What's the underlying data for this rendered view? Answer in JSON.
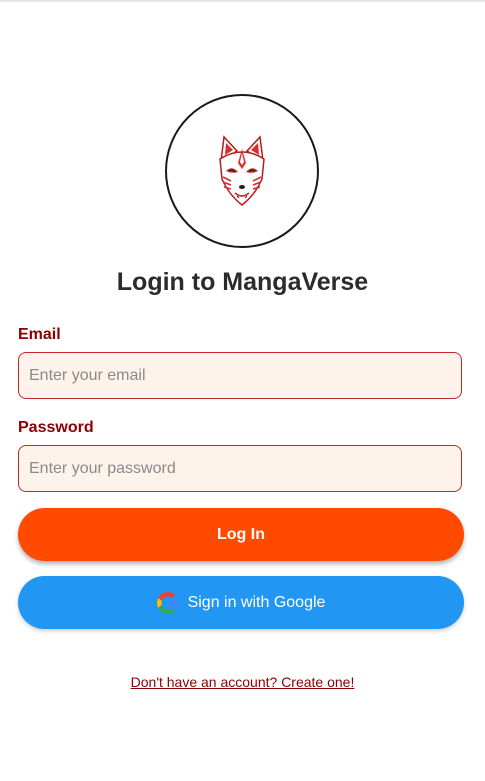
{
  "logo": {
    "icon": "kitsune-mask-icon"
  },
  "title": "Login to MangaVerse",
  "email": {
    "label": "Email",
    "placeholder": "Enter your email",
    "value": ""
  },
  "password": {
    "label": "Password",
    "placeholder": "Enter your password",
    "value": ""
  },
  "login_button": {
    "label": "Log In"
  },
  "google_button": {
    "label": "Sign in with Google",
    "icon": "google-icon"
  },
  "signup_link": {
    "label": "Don't have an account? Create one!"
  },
  "colors": {
    "label": "#8b0000",
    "field_border": "#c62828",
    "field_bg": "#fdf3ea",
    "login_button": "#ff4a00",
    "google_button": "#2196f3"
  }
}
